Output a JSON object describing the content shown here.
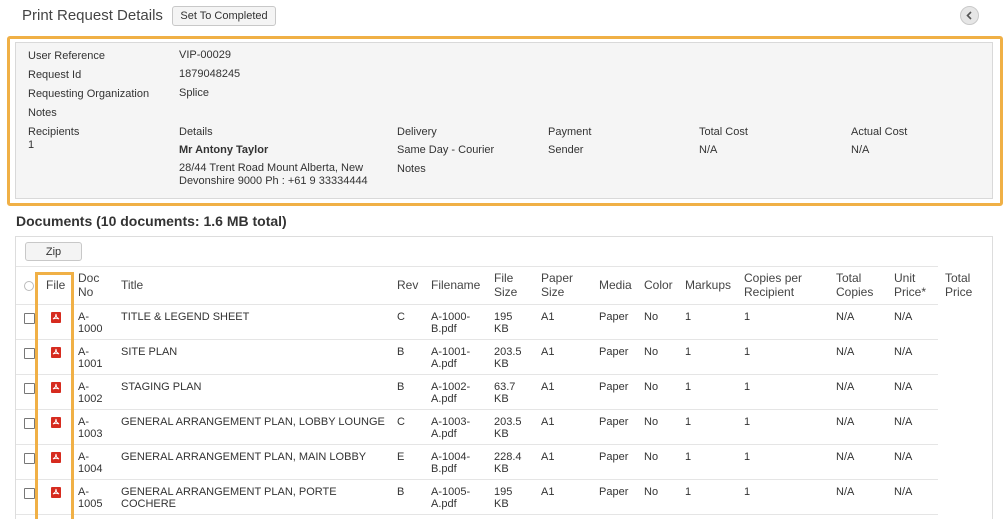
{
  "header": {
    "title": "Print Request Details",
    "complete_button": "Set To Completed"
  },
  "info": {
    "user_reference_label": "User Reference",
    "user_reference": "VIP-00029",
    "request_id_label": "Request Id",
    "request_id": "1879048245",
    "org_label": "Requesting Organization",
    "org": "Splice",
    "notes_label": "Notes",
    "recipients_label": "Recipients",
    "recipients_count": "1",
    "details_label": "Details",
    "details_name": "Mr Antony Taylor",
    "details_address_1": "28/44 Trent Road Mount Alberta, New",
    "details_address_2": "Devonshire 9000 Ph : +61 9 33334444",
    "delivery_label": "Delivery",
    "delivery": "Same Day - Courier",
    "delivery_notes_label": "Notes",
    "payment_label": "Payment",
    "payment": "Sender",
    "total_cost_label": "Total Cost",
    "total_cost": "N/A",
    "actual_cost_label": "Actual Cost",
    "actual_cost": "N/A"
  },
  "documents": {
    "heading": "Documents (10 documents: 1.6 MB total)",
    "zip_button": "Zip",
    "columns": {
      "file": "File",
      "doc_no_1": "Doc",
      "doc_no_2": "No",
      "title": "Title",
      "rev": "Rev",
      "filename": "Filename",
      "file_size_1": "File",
      "file_size_2": "Size",
      "paper_size_1": "Paper",
      "paper_size_2": "Size",
      "media": "Media",
      "color": "Color",
      "markups": "Markups",
      "copies_1": "Copies per",
      "copies_2": "Recipient",
      "total_copies_1": "Total",
      "total_copies_2": "Copies",
      "unit_price_1": "Unit",
      "unit_price_2": "Price*",
      "total_price_1": "Total",
      "total_price_2": "Price"
    },
    "rows": [
      {
        "doc_no_1": "A-",
        "doc_no_2": "1000",
        "title": "TITLE & LEGEND SHEET",
        "rev": "C",
        "filename_1": "A-1000-",
        "filename_2": "B.pdf",
        "size_1": "195",
        "size_2": "KB",
        "paper": "A1",
        "media": "Paper",
        "color": "No",
        "markups": "1",
        "copies": "1",
        "total_copies": "N/A",
        "unit_price": "N/A"
      },
      {
        "doc_no_1": "A-",
        "doc_no_2": "1001",
        "title": "SITE PLAN",
        "rev": "B",
        "filename_1": "A-1001-",
        "filename_2": "A.pdf",
        "size_1": "203.5",
        "size_2": "KB",
        "paper": "A1",
        "media": "Paper",
        "color": "No",
        "markups": "1",
        "copies": "1",
        "total_copies": "N/A",
        "unit_price": "N/A"
      },
      {
        "doc_no_1": "A-",
        "doc_no_2": "1002",
        "title": "STAGING PLAN",
        "rev": "B",
        "filename_1": "A-1002-",
        "filename_2": "A.pdf",
        "size_1": "63.7",
        "size_2": "KB",
        "paper": "A1",
        "media": "Paper",
        "color": "No",
        "markups": "1",
        "copies": "1",
        "total_copies": "N/A",
        "unit_price": "N/A"
      },
      {
        "doc_no_1": "A-",
        "doc_no_2": "1003",
        "title": "GENERAL ARRANGEMENT PLAN, LOBBY LOUNGE",
        "rev": "C",
        "filename_1": "A-1003-",
        "filename_2": "A.pdf",
        "size_1": "203.5",
        "size_2": "KB",
        "paper": "A1",
        "media": "Paper",
        "color": "No",
        "markups": "1",
        "copies": "1",
        "total_copies": "N/A",
        "unit_price": "N/A"
      },
      {
        "doc_no_1": "A-",
        "doc_no_2": "1004",
        "title": "GENERAL ARRANGEMENT PLAN, MAIN LOBBY",
        "rev": "E",
        "filename_1": "A-1004-",
        "filename_2": "B.pdf",
        "size_1": "228.4",
        "size_2": "KB",
        "paper": "A1",
        "media": "Paper",
        "color": "No",
        "markups": "1",
        "copies": "1",
        "total_copies": "N/A",
        "unit_price": "N/A"
      },
      {
        "doc_no_1": "A-",
        "doc_no_2": "1005",
        "title": "GENERAL ARRANGEMENT PLAN, PORTE",
        "title_2": "COCHERE",
        "rev": "B",
        "filename_1": "A-1005-",
        "filename_2": "A.pdf",
        "size_1": "195",
        "size_2": "KB",
        "paper": "A1",
        "media": "Paper",
        "color": "No",
        "markups": "1",
        "copies": "1",
        "total_copies": "N/A",
        "unit_price": "N/A"
      }
    ]
  },
  "icons": {
    "back": "chevron-left-icon",
    "file": "pdf-icon"
  },
  "colors": {
    "highlight": "#f0b046",
    "pdf": "#d62b1f",
    "panel_bg": "#f5f5f5"
  }
}
